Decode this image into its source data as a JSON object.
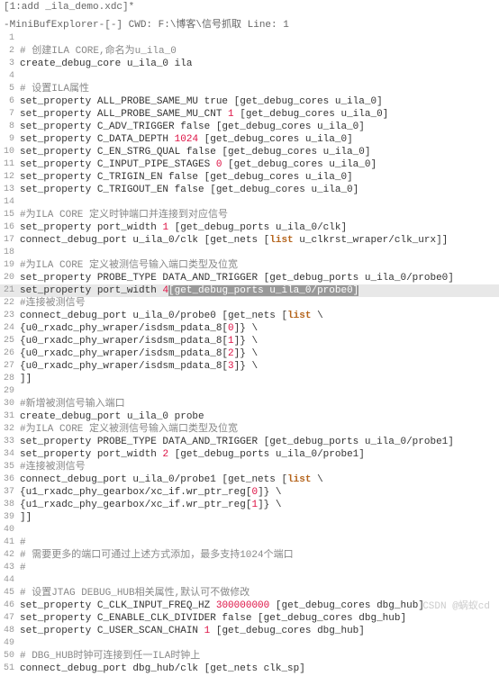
{
  "title": "[1:add _ila_demo.xdc]*",
  "minibuf": "-MiniBufExplorer-[-]   CWD: F:\\博客\\信号抓取   Line: 1",
  "watermark": "CSDN @蜗蚁cd",
  "lines": [
    {
      "n": 1,
      "t": ""
    },
    {
      "n": 2,
      "t": "# 创建ILA CORE,命名为u_ila_0",
      "c": true
    },
    {
      "n": 3,
      "t": "create_debug_core u_ila_0 ila"
    },
    {
      "n": 4,
      "t": ""
    },
    {
      "n": 5,
      "t": "# 设置ILA属性",
      "c": true
    },
    {
      "n": 6,
      "t": "set_property ALL_PROBE_SAME_MU true [get_debug_cores u_ila_0]"
    },
    {
      "n": 7,
      "t": "set_property ALL_PROBE_SAME_MU_CNT ",
      "num": "1",
      "t2": " [get_debug_cores u_ila_0]"
    },
    {
      "n": 8,
      "t": "set_property C_ADV_TRIGGER false [get_debug_cores u_ila_0]"
    },
    {
      "n": 9,
      "t": "set_property C_DATA_DEPTH ",
      "num": "1024",
      "t2": " [get_debug_cores u_ila_0]"
    },
    {
      "n": 10,
      "t": "set_property C_EN_STRG_QUAL false [get_debug_cores u_ila_0]"
    },
    {
      "n": 11,
      "t": "set_property C_INPUT_PIPE_STAGES ",
      "num": "0",
      "t2": " [get_debug_cores u_ila_0]"
    },
    {
      "n": 12,
      "t": "set_property C_TRIGIN_EN false [get_debug_cores u_ila_0]"
    },
    {
      "n": 13,
      "t": "set_property C_TRIGOUT_EN false [get_debug_cores u_ila_0]"
    },
    {
      "n": 14,
      "t": ""
    },
    {
      "n": 15,
      "t": "#为ILA CORE 定义时钟端口并连接到对应信号",
      "c": true
    },
    {
      "n": 16,
      "t": "set_property port_width ",
      "num": "1",
      "t2": " [get_debug_ports u_ila_0/clk]"
    },
    {
      "n": 17,
      "t": "connect_debug_port u_ila_0/clk [get_nets [",
      "kw": "list",
      "t2": " u_clkrst_wraper/clk_urx]]"
    },
    {
      "n": 18,
      "t": ""
    },
    {
      "n": 19,
      "t": "#为ILA CORE 定义被测信号输入端口类型及位宽",
      "c": true
    },
    {
      "n": 20,
      "t": "set_property PROBE_TYPE DATA_AND_TRIGGER [get_debug_ports u_ila_0/probe0]"
    },
    {
      "n": 21,
      "t": "set_property port_width ",
      "num": "4",
      "t2": " ",
      "sel": "[get_debug_ports u_ila_0/probe0]",
      "hl": true
    },
    {
      "n": 22,
      "t": "#连接被测信号",
      "c": true
    },
    {
      "n": 23,
      "t": "connect_debug_port u_ila_0/probe0 [get_nets [",
      "kw": "list",
      "t2": " \\"
    },
    {
      "n": 24,
      "t": "{u0_rxadc_phy_wraper/isdsm_pdata_8[",
      "num": "0",
      "t2": "]} \\"
    },
    {
      "n": 25,
      "t": "{u0_rxadc_phy_wraper/isdsm_pdata_8[",
      "num": "1",
      "t2": "]} \\"
    },
    {
      "n": 26,
      "t": "{u0_rxadc_phy_wraper/isdsm_pdata_8[",
      "num": "2",
      "t2": "]} \\"
    },
    {
      "n": 27,
      "t": "{u0_rxadc_phy_wraper/isdsm_pdata_8[",
      "num": "3",
      "t2": "]} \\"
    },
    {
      "n": 28,
      "t": "]]"
    },
    {
      "n": 29,
      "t": ""
    },
    {
      "n": 30,
      "t": "#新增被测信号输入端口",
      "c": true
    },
    {
      "n": 31,
      "t": "create_debug_port u_ila_0 probe"
    },
    {
      "n": 32,
      "t": "#为ILA CORE 定义被测信号输入端口类型及位宽",
      "c": true
    },
    {
      "n": 33,
      "t": "set_property PROBE_TYPE DATA_AND_TRIGGER [get_debug_ports u_ila_0/probe1]"
    },
    {
      "n": 34,
      "t": "set_property port_width ",
      "num": "2",
      "t2": " [get_debug_ports u_ila_0/probe1]"
    },
    {
      "n": 35,
      "t": "#连接被测信号",
      "c": true
    },
    {
      "n": 36,
      "t": "connect_debug_port u_ila_0/probe1 [get_nets [",
      "kw": "list",
      "t2": " \\"
    },
    {
      "n": 37,
      "t": "{u1_rxadc_phy_gearbox/xc_if.wr_ptr_reg[",
      "num": "0",
      "t2": "]} \\"
    },
    {
      "n": 38,
      "t": "{u1_rxadc_phy_gearbox/xc_if.wr_ptr_reg[",
      "num": "1",
      "t2": "]} \\"
    },
    {
      "n": 39,
      "t": "]]"
    },
    {
      "n": 40,
      "t": ""
    },
    {
      "n": 41,
      "t": "#",
      "c": true
    },
    {
      "n": 42,
      "t": "# 需要更多的端口可通过上述方式添加，最多支持1024个端口",
      "c": true
    },
    {
      "n": 43,
      "t": "#",
      "c": true
    },
    {
      "n": 44,
      "t": ""
    },
    {
      "n": 45,
      "t": "# 设置JTAG DEBUG_HUB相关属性,默认可不做修改",
      "c": true
    },
    {
      "n": 46,
      "t": "set_property C_CLK_INPUT_FREQ_HZ ",
      "num": "300000000",
      "t2": " [get_debug_cores dbg_hub]"
    },
    {
      "n": 47,
      "t": "set_property C_ENABLE_CLK_DIVIDER false [get_debug_cores dbg_hub]"
    },
    {
      "n": 48,
      "t": "set_property C_USER_SCAN_CHAIN ",
      "num": "1",
      "t2": " [get_debug_cores dbg_hub]"
    },
    {
      "n": 49,
      "t": ""
    },
    {
      "n": 50,
      "t": "# DBG_HUB时钟可连接到任一ILA时钟上",
      "c": true
    },
    {
      "n": 51,
      "t": "connect_debug_port dbg_hub/clk [get_nets clk_sp]"
    }
  ]
}
